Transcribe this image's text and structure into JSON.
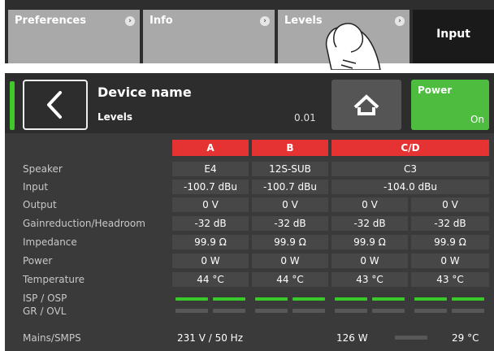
{
  "tabs": [
    {
      "label": "Preferences"
    },
    {
      "label": "Info"
    },
    {
      "label": "Levels"
    }
  ],
  "tab_input": "Input",
  "device": {
    "title": "Device name",
    "subtitle": "Levels",
    "version": "0.01",
    "power_label": "Power",
    "power_state": "On"
  },
  "columns": [
    "A",
    "B",
    "C/D"
  ],
  "rows": {
    "speaker": {
      "label": "Speaker",
      "values": [
        "E4",
        "12S-SUB",
        "C3"
      ]
    },
    "input": {
      "label": "Input",
      "values": [
        "-100.7 dBu",
        "-100.7 dBu",
        "-104.0 dBu"
      ]
    },
    "output": {
      "label": "Output",
      "values": [
        "0 V",
        "0 V",
        "0 V",
        "0 V"
      ]
    },
    "gain": {
      "label": "Gainreduction/Headroom",
      "values": [
        "-32 dB",
        "-32 dB",
        "-32 dB",
        "-32 dB"
      ]
    },
    "impedance": {
      "label": "Impedance",
      "values": [
        "99.9 Ω",
        "99.9 Ω",
        "99.9 Ω",
        "99.9 Ω"
      ]
    },
    "power": {
      "label": "Power",
      "values": [
        "0 W",
        "0 W",
        "0 W",
        "0 W"
      ]
    },
    "temperature": {
      "label": "Temperature",
      "values": [
        "44 °C",
        "44 °C",
        "43 °C",
        "43 °C"
      ]
    }
  },
  "isp_label": "ISP / OSP",
  "gr_label": "GR / OVL",
  "mains": {
    "label": "Mains/SMPS",
    "voltage": "231 V / 50 Hz",
    "power": "126 W",
    "temp": "29 °C"
  },
  "icons": {
    "back": "chevron-left-icon",
    "home": "home-icon",
    "hand": "tap-hand-icon"
  }
}
